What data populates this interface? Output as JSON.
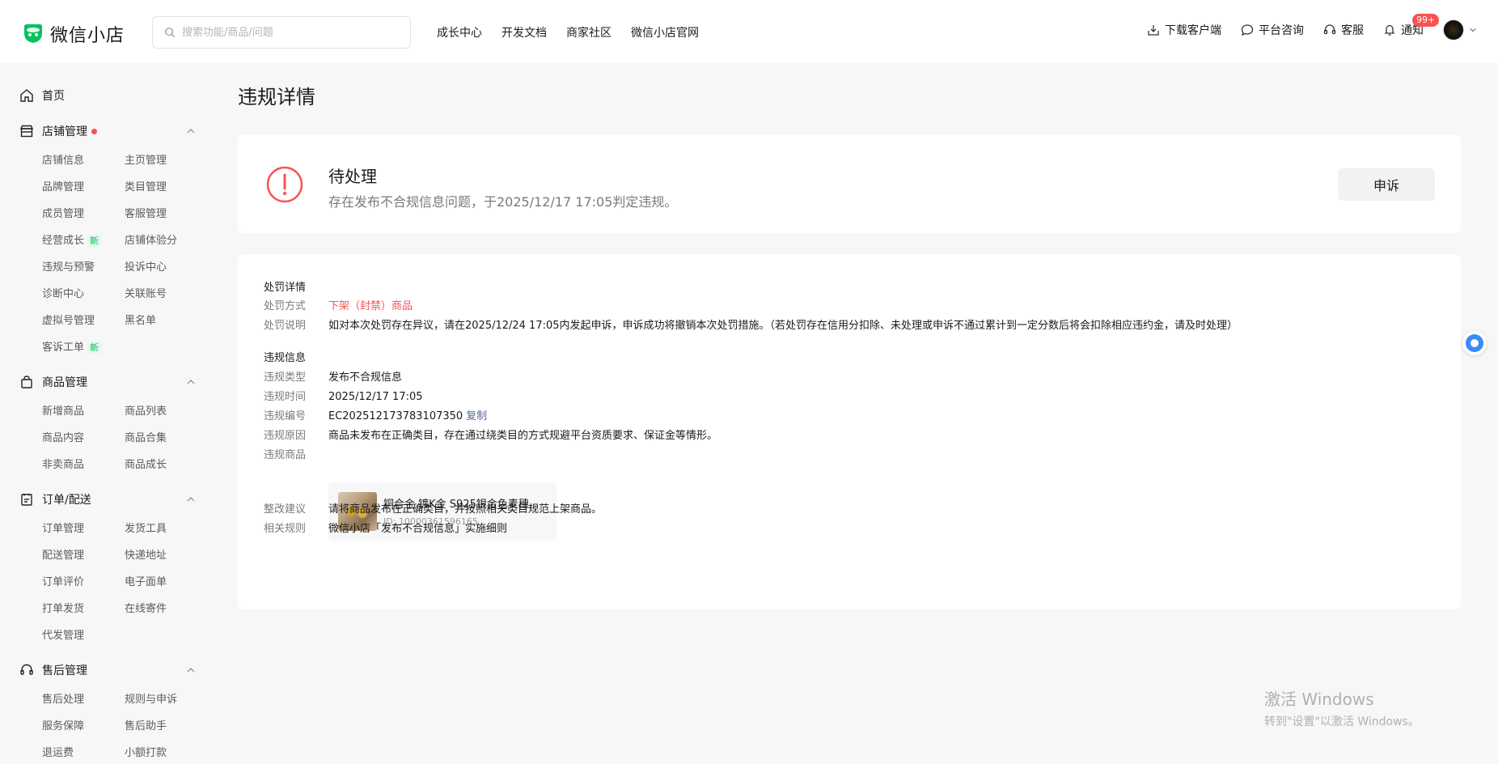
{
  "app": {
    "name": "微信小店"
  },
  "search": {
    "placeholder": "搜索功能/商品/问题"
  },
  "topnav": [
    "成长中心",
    "开发文档",
    "商家社区",
    "微信小店官网"
  ],
  "topright": {
    "download": "下载客户端",
    "consult": "平台咨询",
    "service": "客服",
    "notify": "通知",
    "notify_badge": "99+"
  },
  "sidebar": {
    "home": "首页",
    "groups": [
      {
        "title": "店铺管理",
        "has_dot": true,
        "items": [
          "店铺信息",
          "主页管理",
          "品牌管理",
          "类目管理",
          "成员管理",
          "客服管理",
          "经营成长",
          "店铺体验分",
          "违规与预警",
          "投诉中心",
          "诊断中心",
          "关联账号",
          "虚拟号管理",
          "黑名单",
          "客诉工单"
        ]
      },
      {
        "title": "商品管理",
        "items": [
          "新增商品",
          "商品列表",
          "商品内容",
          "商品合集",
          "非卖商品",
          "商品成长"
        ]
      },
      {
        "title": "订单/配送",
        "items": [
          "订单管理",
          "发货工具",
          "配送管理",
          "快递地址",
          "订单评价",
          "电子面单",
          "打单发货",
          "在线寄件",
          "代发管理"
        ]
      },
      {
        "title": "售后管理",
        "items": [
          "售后处理",
          "规则与申诉",
          "服务保障",
          "售后助手",
          "退运费",
          "小额打款"
        ]
      }
    ],
    "new_tag": "新"
  },
  "page": {
    "title": "违规详情",
    "status": {
      "title": "待处理",
      "desc": "存在发布不合规信息问题，于2025/12/17 17:05判定违规。",
      "appeal_button": "申诉"
    },
    "penalty": {
      "section_title": "处罚详情",
      "method_label": "处罚方式",
      "method_value": "下架（封禁）商品",
      "explain_label": "处罚说明",
      "explain_value": "如对本次处罚存在异议，请在2025/12/24 17:05内发起申诉，申诉成功将撤销本次处罚措施。（若处罚存在信用分扣除、未处理或申诉不通过累计到一定分数后将会扣除相应违约金，请及时处理）"
    },
    "violation": {
      "section_title": "违规信息",
      "type_label": "违规类型",
      "type_value": "发布不合规信息",
      "time_label": "违规时间",
      "time_value": "2025/12/17 17:05",
      "id_label": "违规编号",
      "id_value": "EC202512173783107350",
      "copy_link": "复制",
      "reason_label": "违规原因",
      "reason_value": "商品未发布在正确类目，存在通过绕类目的方式规避平台资质要求、保证金等情形。",
      "product_label": "违规商品",
      "product_name": "铜合金 镀K金 S925银金色麦穗...",
      "product_id": "ID: 10000361596165",
      "suggest_label": "整改建议",
      "suggest_value": "请将商品发布在正确类目，并按照相关类目规范上架商品。",
      "rule_label": "相关规则",
      "rule_value": "微信小店「发布不合规信息」实施细则"
    }
  },
  "watermark": {
    "line1": "激活 Windows",
    "line2": "转到\"设置\"以激活 Windows。"
  },
  "colors": {
    "brand": "#07c160",
    "danger": "#fa5151",
    "link": "#576b95"
  }
}
